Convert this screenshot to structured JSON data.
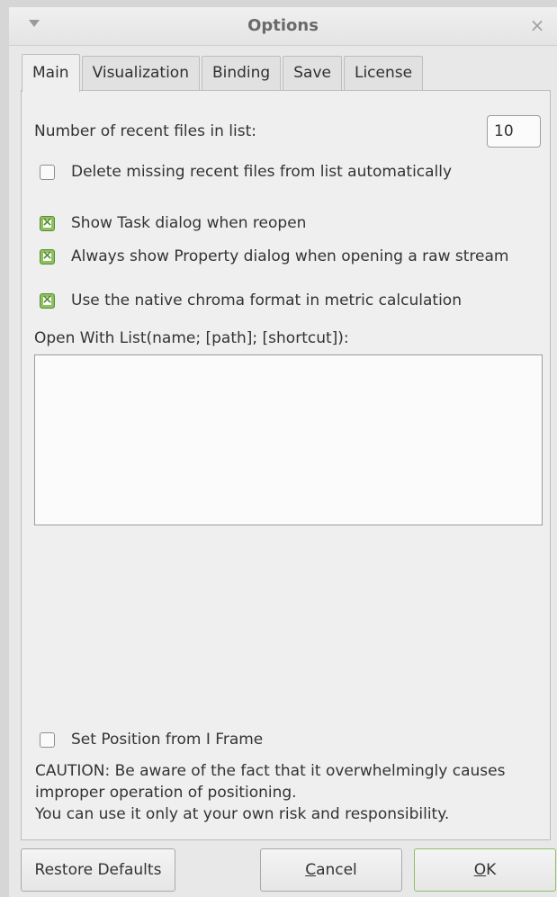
{
  "window": {
    "title": "Options"
  },
  "tabs": [
    {
      "label": "Main",
      "active": true
    },
    {
      "label": "Visualization",
      "active": false
    },
    {
      "label": "Binding",
      "active": false
    },
    {
      "label": "Save",
      "active": false
    },
    {
      "label": "License",
      "active": false
    }
  ],
  "main": {
    "recent_files_label": "Number of recent files in list:",
    "recent_files_value": "10",
    "delete_missing": {
      "label": "Delete missing recent files from list automatically",
      "checked": false
    },
    "show_task_dialog": {
      "label": "Show Task dialog when reopen",
      "checked": true
    },
    "always_show_property": {
      "label": "Always show Property dialog when opening a raw stream",
      "checked": true
    },
    "native_chroma": {
      "label": "Use the native chroma format in metric calculation",
      "checked": true
    },
    "open_with_label": "Open With List(name; [path]; [shortcut]):",
    "open_with_value": "",
    "set_position": {
      "label": "Set Position from I Frame",
      "checked": false
    },
    "caution_lines": [
      "CAUTION: Be aware of the fact that it overwhelmingly causes",
      "improper operation of positioning.",
      "You can use it only at your own risk and responsibility."
    ]
  },
  "buttons": {
    "restore_defaults": "Restore Defaults",
    "cancel_prefix": "C",
    "cancel_rest": "ancel",
    "ok_prefix": "O",
    "ok_rest": "K"
  },
  "colors": {
    "checkbox_checked": "#8cc15c",
    "ok_border": "#8fbf6a"
  }
}
